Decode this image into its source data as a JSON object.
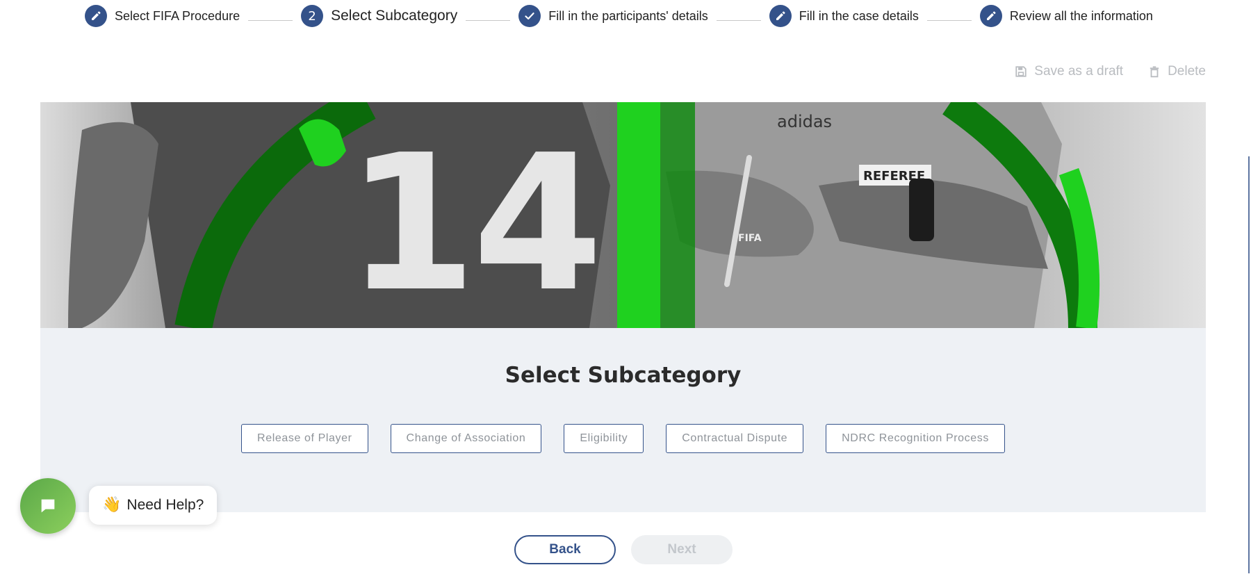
{
  "stepper": {
    "steps": [
      {
        "label": "Select FIFA Procedure",
        "icon": "pencil-icon"
      },
      {
        "label": "Select Subcategory",
        "number": "2",
        "active": true
      },
      {
        "label": "Fill in the participants' details",
        "icon": "check-icon"
      },
      {
        "label": "Fill in the case details",
        "icon": "pencil-icon"
      },
      {
        "label": "Review all the information",
        "icon": "pencil-icon"
      }
    ]
  },
  "toolbar": {
    "save_draft_label": "Save as a draft",
    "delete_label": "Delete"
  },
  "hero": {
    "jersey_number": "14",
    "brand_text": "adidas",
    "badge_text": "REFEREE",
    "crest_text": "FIFA"
  },
  "main": {
    "title": "Select Subcategory",
    "options": [
      "Release of Player",
      "Change of Association",
      "Eligibility",
      "Contractual Dispute",
      "NDRC Recognition Process"
    ]
  },
  "nav": {
    "back_label": "Back",
    "next_label": "Next"
  },
  "chat": {
    "help_text": "Need Help?",
    "help_emoji": "👋"
  },
  "colors": {
    "primary": "#34528a",
    "accent_green": "#1fd11f",
    "panel_bg": "#eef1f5"
  }
}
